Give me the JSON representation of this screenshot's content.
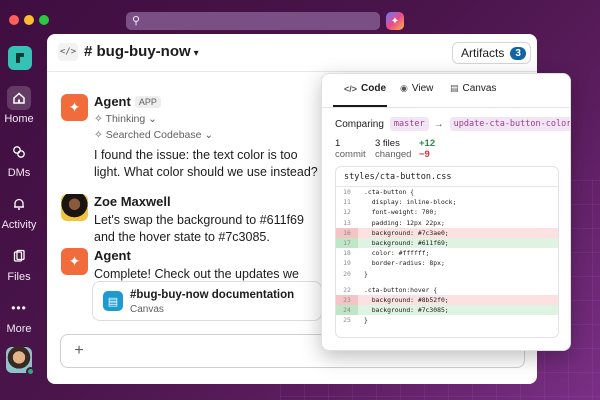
{
  "window": {
    "search_placeholder": ""
  },
  "sidebar": {
    "items": [
      {
        "label": "Home",
        "icon": "home-icon",
        "active": true
      },
      {
        "label": "DMs",
        "icon": "dms-icon",
        "active": false
      },
      {
        "label": "Activity",
        "icon": "bell-icon",
        "active": false
      },
      {
        "label": "Files",
        "icon": "files-icon",
        "active": false
      },
      {
        "label": "More",
        "icon": "more-icon",
        "active": false
      }
    ]
  },
  "channel": {
    "name": "bug-buy-now",
    "hash": "#",
    "artifacts_label": "Artifacts",
    "artifacts_count": "3"
  },
  "messages": [
    {
      "sender": "Agent",
      "badge": "APP",
      "status": "Thinking",
      "status2": "Searched Codebase",
      "text": "I found the issue: the text color is too light. What color should we use instead?"
    },
    {
      "sender": "Zoe Maxwell",
      "text": "Let's swap the background to #611f69 and the hover state to #7c3085."
    },
    {
      "sender": "Agent",
      "text": "Complete! Check out the updates we made:",
      "card_title": "#bug-buy-now documentation",
      "card_sub": "Canvas"
    }
  ],
  "panel": {
    "tabs": [
      {
        "label": "Code",
        "icon": "code-icon"
      },
      {
        "label": "View",
        "icon": "eye-icon"
      },
      {
        "label": "Canvas",
        "icon": "canvas-icon"
      }
    ],
    "comparing_label": "Comparing",
    "base_branch": "master",
    "arrow": "→",
    "compare_branch": "update-cta-button-color",
    "commit_count": "1",
    "commit_label": "commit",
    "files_count": "3 files",
    "files_label": "changed",
    "additions": "+12",
    "deletions": "−9",
    "file_name": "styles/cta-button.css",
    "lines": [
      {
        "n": "10",
        "t": ".cta-button {",
        "k": "ctx"
      },
      {
        "n": "11",
        "t": "  display: inline-block;",
        "k": "ctx"
      },
      {
        "n": "12",
        "t": "  font-weight: 700;",
        "k": "ctx"
      },
      {
        "n": "13",
        "t": "  padding: 12px 22px;",
        "k": "ctx"
      },
      {
        "n": "16",
        "t": "  background: #7c3ae0;",
        "k": "del"
      },
      {
        "n": "17",
        "t": "  background: #611f69;",
        "k": "add"
      },
      {
        "n": "18",
        "t": "  color: #ffffff;",
        "k": "ctx"
      },
      {
        "n": "19",
        "t": "  border-radius: 8px;",
        "k": "ctx"
      },
      {
        "n": "20",
        "t": "}",
        "k": "ctx"
      },
      {
        "n": "",
        "t": "",
        "k": "gap"
      },
      {
        "n": "22",
        "t": ".cta-button:hover {",
        "k": "ctx"
      },
      {
        "n": "23",
        "t": "  background: #8b52f0;",
        "k": "del"
      },
      {
        "n": "24",
        "t": "  background: #7c3085;",
        "k": "add"
      },
      {
        "n": "25",
        "t": "}",
        "k": "ctx"
      }
    ]
  }
}
